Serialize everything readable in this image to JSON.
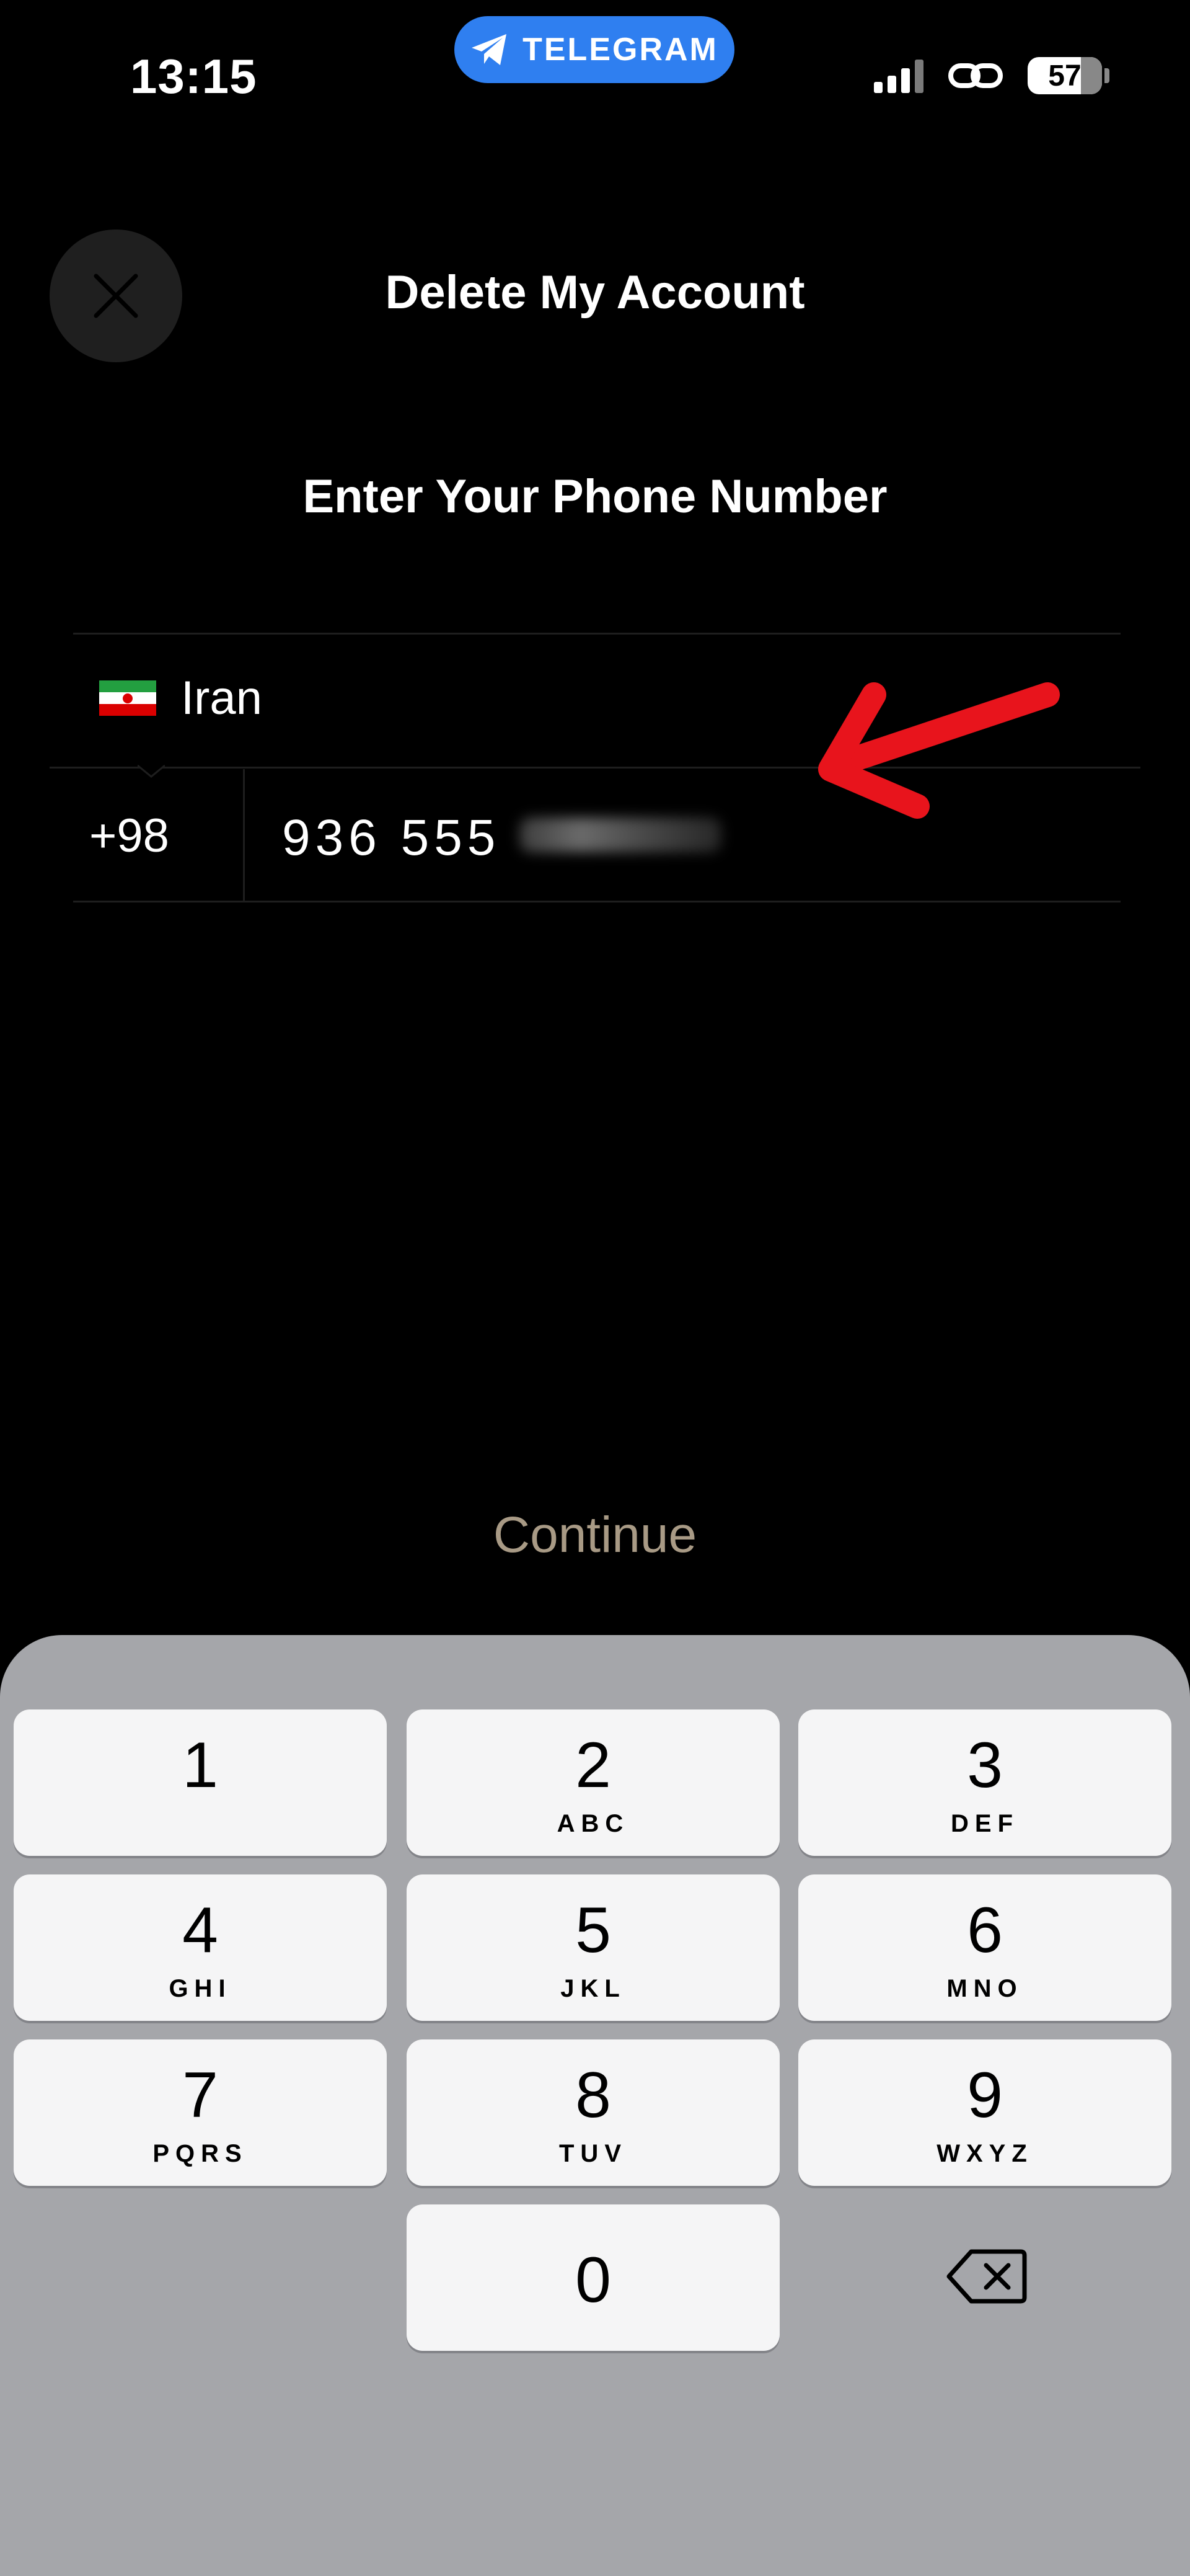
{
  "status_bar": {
    "time": "13:15",
    "app_pill_label": "TELEGRAM",
    "battery_level": "57",
    "accent": "#2f7ff0"
  },
  "header": {
    "title": "Delete My Account",
    "close_icon": "close-icon"
  },
  "form": {
    "subtitle": "Enter Your Phone Number",
    "country_name": "Iran",
    "country_code": "+98",
    "phone_visible": "936 555"
  },
  "continue_label": "Continue",
  "keypad": {
    "keys": [
      {
        "digit": "1",
        "letters": ""
      },
      {
        "digit": "2",
        "letters": "ABC"
      },
      {
        "digit": "3",
        "letters": "DEF"
      },
      {
        "digit": "4",
        "letters": "GHI"
      },
      {
        "digit": "5",
        "letters": "JKL"
      },
      {
        "digit": "6",
        "letters": "MNO"
      },
      {
        "digit": "7",
        "letters": "PQRS"
      },
      {
        "digit": "8",
        "letters": "TUV"
      },
      {
        "digit": "9",
        "letters": "WXYZ"
      },
      {
        "digit": "0",
        "letters": ""
      }
    ],
    "delete_icon": "backspace-icon"
  },
  "annotation": {
    "arrow_color": "#e8141c"
  }
}
